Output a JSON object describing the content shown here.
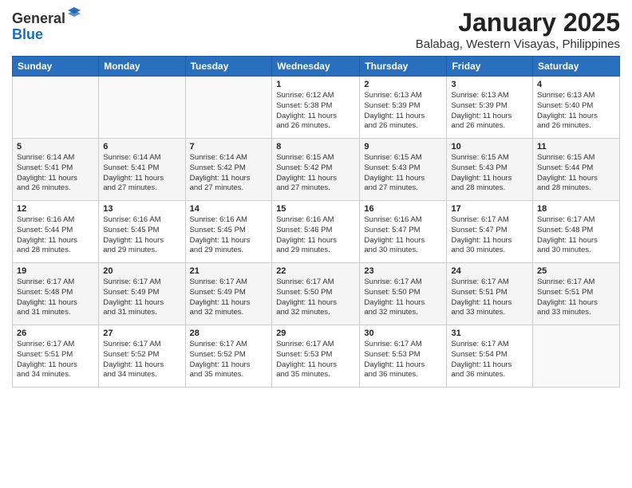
{
  "header": {
    "logo_line1": "General",
    "logo_line2": "Blue",
    "title": "January 2025",
    "subtitle": "Balabag, Western Visayas, Philippines"
  },
  "weekdays": [
    "Sunday",
    "Monday",
    "Tuesday",
    "Wednesday",
    "Thursday",
    "Friday",
    "Saturday"
  ],
  "weeks": [
    [
      {
        "day": "",
        "info": ""
      },
      {
        "day": "",
        "info": ""
      },
      {
        "day": "",
        "info": ""
      },
      {
        "day": "1",
        "info": "Sunrise: 6:12 AM\nSunset: 5:38 PM\nDaylight: 11 hours\nand 26 minutes."
      },
      {
        "day": "2",
        "info": "Sunrise: 6:13 AM\nSunset: 5:39 PM\nDaylight: 11 hours\nand 26 minutes."
      },
      {
        "day": "3",
        "info": "Sunrise: 6:13 AM\nSunset: 5:39 PM\nDaylight: 11 hours\nand 26 minutes."
      },
      {
        "day": "4",
        "info": "Sunrise: 6:13 AM\nSunset: 5:40 PM\nDaylight: 11 hours\nand 26 minutes."
      }
    ],
    [
      {
        "day": "5",
        "info": "Sunrise: 6:14 AM\nSunset: 5:41 PM\nDaylight: 11 hours\nand 26 minutes."
      },
      {
        "day": "6",
        "info": "Sunrise: 6:14 AM\nSunset: 5:41 PM\nDaylight: 11 hours\nand 27 minutes."
      },
      {
        "day": "7",
        "info": "Sunrise: 6:14 AM\nSunset: 5:42 PM\nDaylight: 11 hours\nand 27 minutes."
      },
      {
        "day": "8",
        "info": "Sunrise: 6:15 AM\nSunset: 5:42 PM\nDaylight: 11 hours\nand 27 minutes."
      },
      {
        "day": "9",
        "info": "Sunrise: 6:15 AM\nSunset: 5:43 PM\nDaylight: 11 hours\nand 27 minutes."
      },
      {
        "day": "10",
        "info": "Sunrise: 6:15 AM\nSunset: 5:43 PM\nDaylight: 11 hours\nand 28 minutes."
      },
      {
        "day": "11",
        "info": "Sunrise: 6:15 AM\nSunset: 5:44 PM\nDaylight: 11 hours\nand 28 minutes."
      }
    ],
    [
      {
        "day": "12",
        "info": "Sunrise: 6:16 AM\nSunset: 5:44 PM\nDaylight: 11 hours\nand 28 minutes."
      },
      {
        "day": "13",
        "info": "Sunrise: 6:16 AM\nSunset: 5:45 PM\nDaylight: 11 hours\nand 29 minutes."
      },
      {
        "day": "14",
        "info": "Sunrise: 6:16 AM\nSunset: 5:45 PM\nDaylight: 11 hours\nand 29 minutes."
      },
      {
        "day": "15",
        "info": "Sunrise: 6:16 AM\nSunset: 5:46 PM\nDaylight: 11 hours\nand 29 minutes."
      },
      {
        "day": "16",
        "info": "Sunrise: 6:16 AM\nSunset: 5:47 PM\nDaylight: 11 hours\nand 30 minutes."
      },
      {
        "day": "17",
        "info": "Sunrise: 6:17 AM\nSunset: 5:47 PM\nDaylight: 11 hours\nand 30 minutes."
      },
      {
        "day": "18",
        "info": "Sunrise: 6:17 AM\nSunset: 5:48 PM\nDaylight: 11 hours\nand 30 minutes."
      }
    ],
    [
      {
        "day": "19",
        "info": "Sunrise: 6:17 AM\nSunset: 5:48 PM\nDaylight: 11 hours\nand 31 minutes."
      },
      {
        "day": "20",
        "info": "Sunrise: 6:17 AM\nSunset: 5:49 PM\nDaylight: 11 hours\nand 31 minutes."
      },
      {
        "day": "21",
        "info": "Sunrise: 6:17 AM\nSunset: 5:49 PM\nDaylight: 11 hours\nand 32 minutes."
      },
      {
        "day": "22",
        "info": "Sunrise: 6:17 AM\nSunset: 5:50 PM\nDaylight: 11 hours\nand 32 minutes."
      },
      {
        "day": "23",
        "info": "Sunrise: 6:17 AM\nSunset: 5:50 PM\nDaylight: 11 hours\nand 32 minutes."
      },
      {
        "day": "24",
        "info": "Sunrise: 6:17 AM\nSunset: 5:51 PM\nDaylight: 11 hours\nand 33 minutes."
      },
      {
        "day": "25",
        "info": "Sunrise: 6:17 AM\nSunset: 5:51 PM\nDaylight: 11 hours\nand 33 minutes."
      }
    ],
    [
      {
        "day": "26",
        "info": "Sunrise: 6:17 AM\nSunset: 5:51 PM\nDaylight: 11 hours\nand 34 minutes."
      },
      {
        "day": "27",
        "info": "Sunrise: 6:17 AM\nSunset: 5:52 PM\nDaylight: 11 hours\nand 34 minutes."
      },
      {
        "day": "28",
        "info": "Sunrise: 6:17 AM\nSunset: 5:52 PM\nDaylight: 11 hours\nand 35 minutes."
      },
      {
        "day": "29",
        "info": "Sunrise: 6:17 AM\nSunset: 5:53 PM\nDaylight: 11 hours\nand 35 minutes."
      },
      {
        "day": "30",
        "info": "Sunrise: 6:17 AM\nSunset: 5:53 PM\nDaylight: 11 hours\nand 36 minutes."
      },
      {
        "day": "31",
        "info": "Sunrise: 6:17 AM\nSunset: 5:54 PM\nDaylight: 11 hours\nand 36 minutes."
      },
      {
        "day": "",
        "info": ""
      }
    ]
  ]
}
